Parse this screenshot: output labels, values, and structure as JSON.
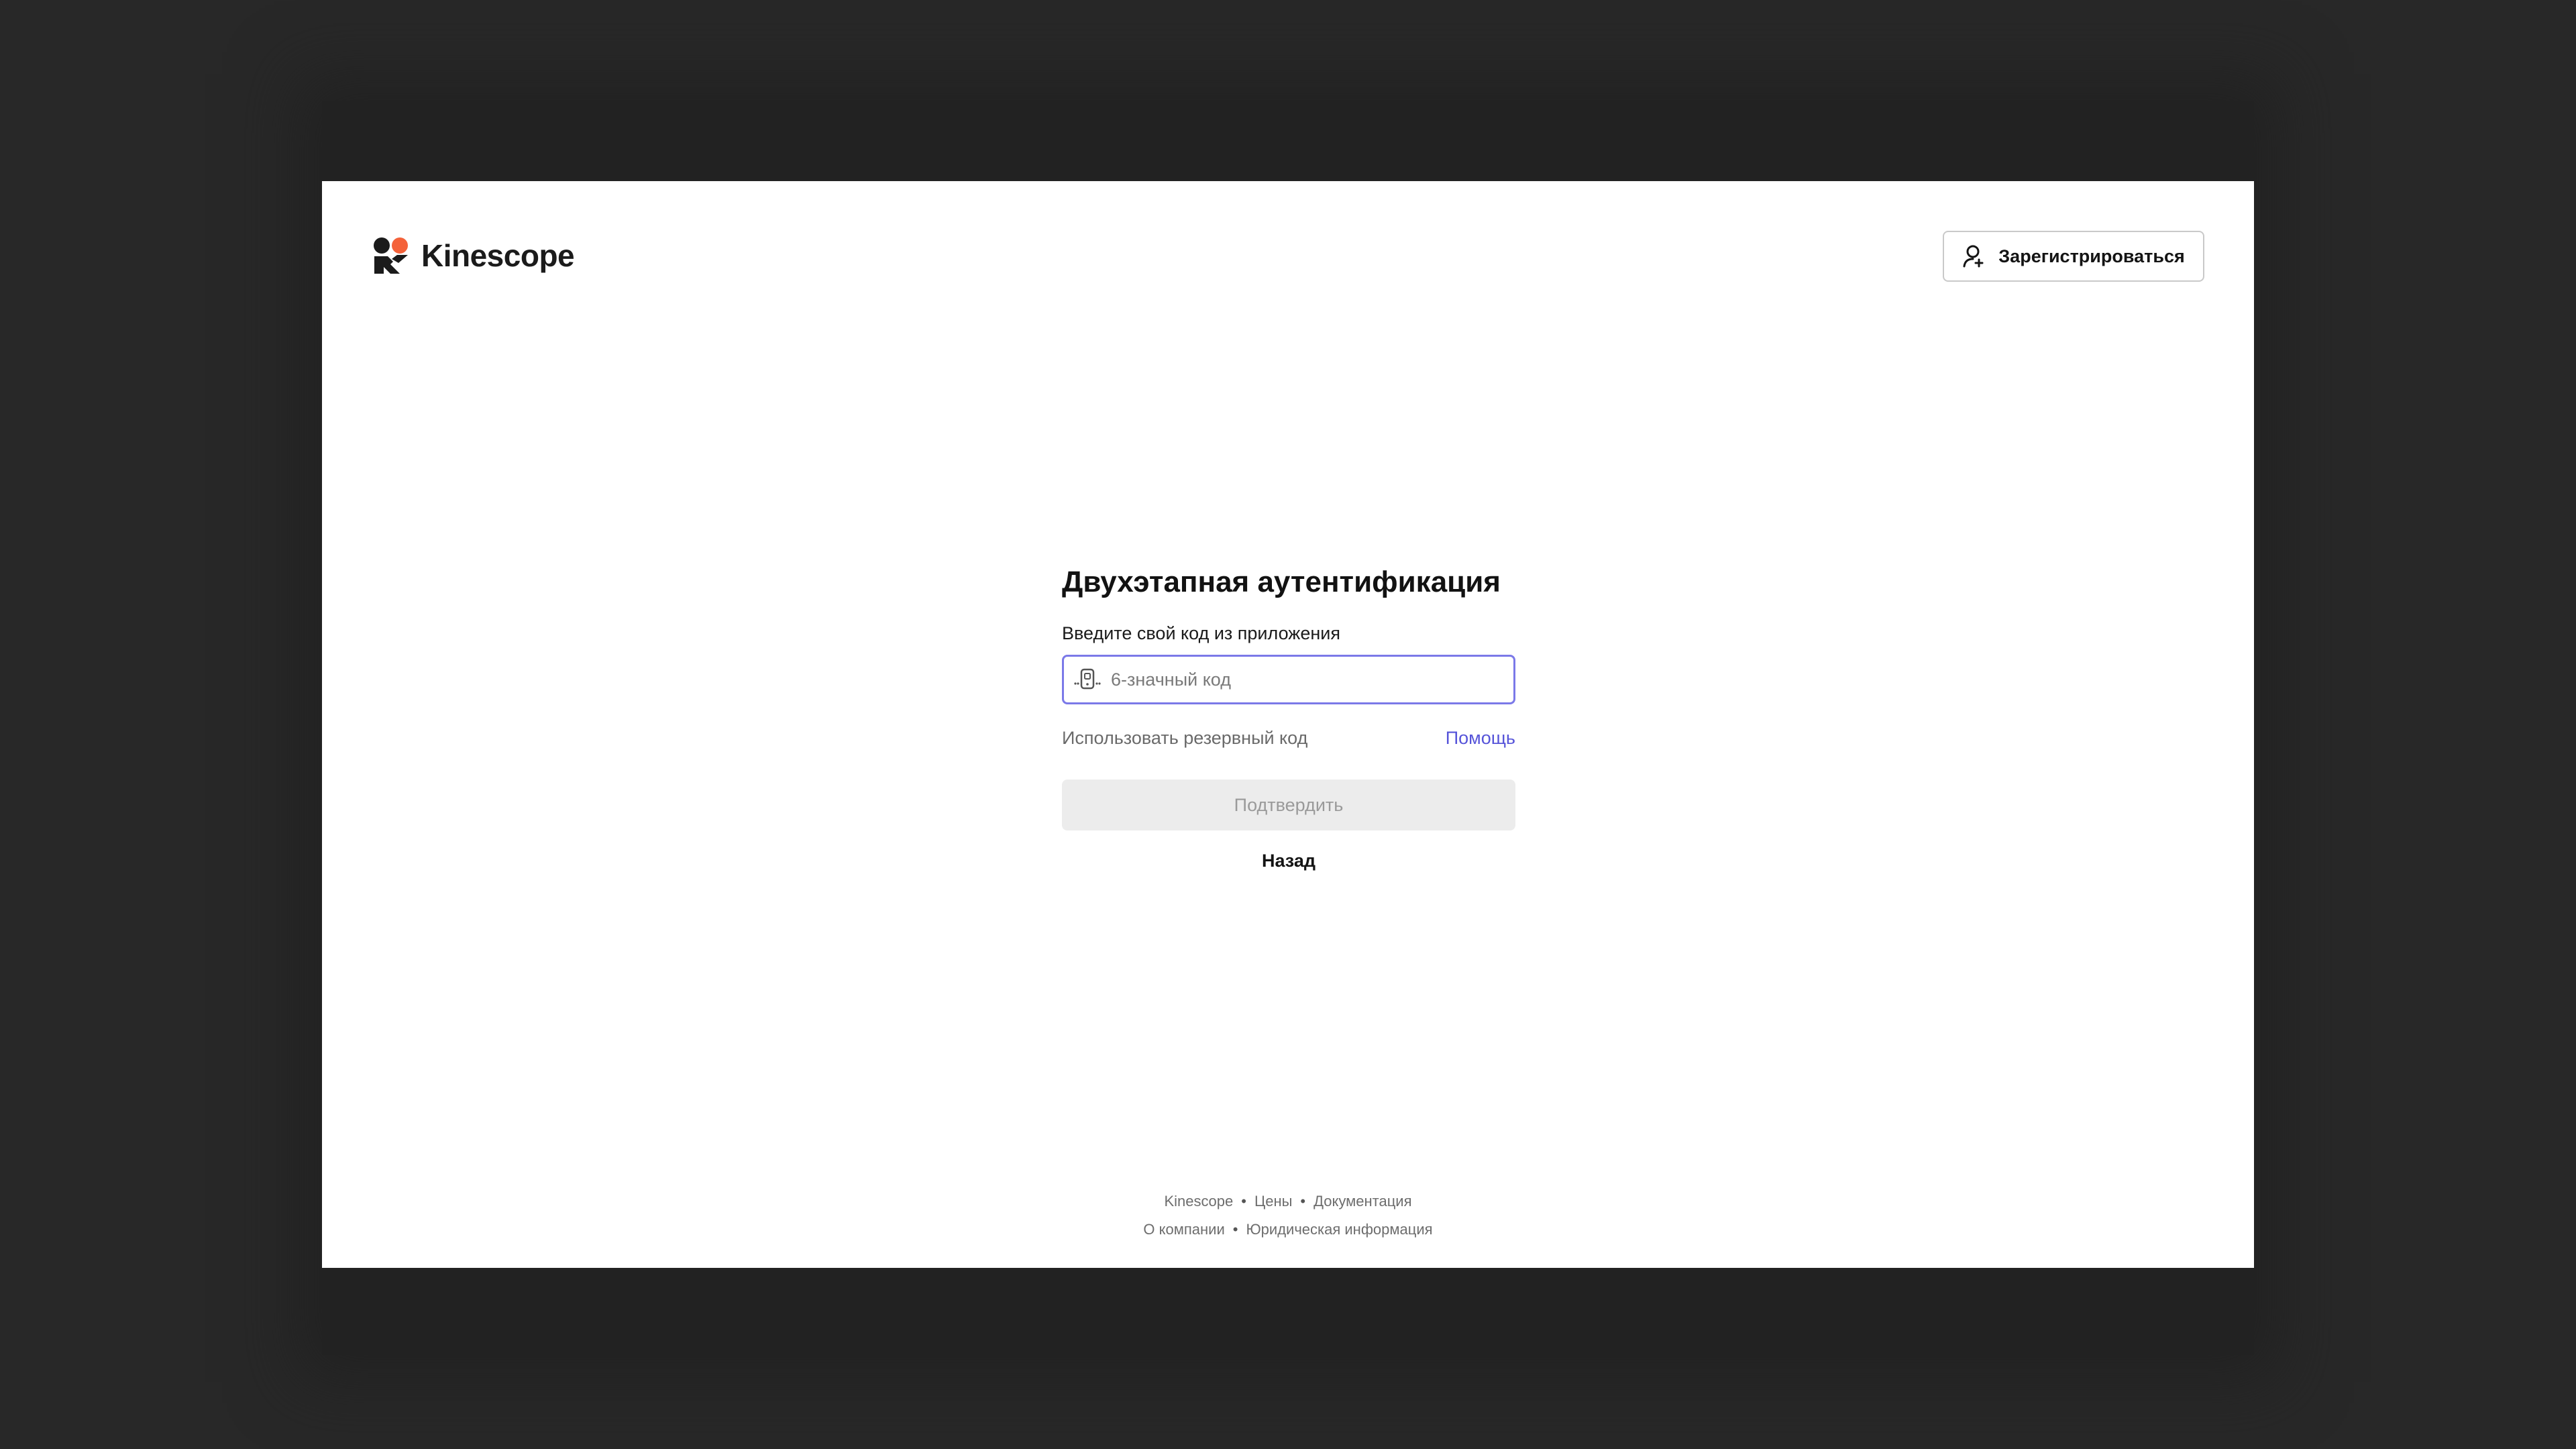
{
  "header": {
    "logo_text": "Kinescope",
    "signup_label": "Зарегистрироваться"
  },
  "form": {
    "title": "Двухэтапная аутентификация",
    "field_label": "Введите свой код из приложения",
    "code_placeholder": "6-значный код",
    "backup_link": "Использовать резервный код",
    "help_link": "Помощь",
    "submit_label": "Подтвердить",
    "back_label": "Назад"
  },
  "footer": {
    "row1": [
      "Kinescope",
      "Цены",
      "Документация"
    ],
    "row2": [
      "О компании",
      "Юридическая информация"
    ],
    "separator": "•"
  },
  "colors": {
    "accent": "#5654d9",
    "input_focus_border": "#7b79e8",
    "logo_orange": "#f4623a",
    "logo_dark": "#1b1b1b",
    "page_background": "#282828"
  },
  "icons": {
    "logo": "kinescope-logo-mark",
    "signup": "user-add-icon",
    "input": "authenticator-app-icon"
  }
}
